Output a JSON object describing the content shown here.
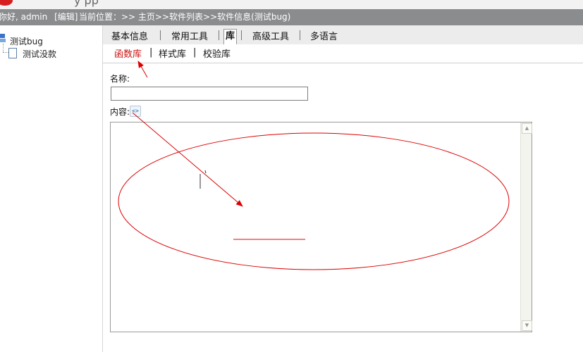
{
  "header": {
    "app_title_fragment": "y pp",
    "greeting": "你好, admin",
    "edit_link": "[编辑]",
    "location": "当前位置：>> 主页>>软件列表>>软件信息(测试bug)"
  },
  "sidebar": {
    "tree": {
      "root_label": "测试bug",
      "child_label": "测试没款"
    }
  },
  "tabs": [
    {
      "label": "基本信息"
    },
    {
      "label": "常用工具"
    },
    {
      "label": "库",
      "active": true
    },
    {
      "label": "高级工具"
    },
    {
      "label": "多语言"
    }
  ],
  "subtabs": {
    "items": [
      {
        "label": "函数库",
        "active": true
      },
      {
        "label": "样式库"
      },
      {
        "label": "校验库"
      }
    ],
    "separator": "|"
  },
  "form": {
    "name_label": "名称:",
    "name_value": "",
    "content_label": "内容:",
    "source_icon": "code-source-icon",
    "content_value": ""
  },
  "colors": {
    "statusbar": "#8a8c8e",
    "active_subtab": "#cc1111",
    "annotation": "#dd0000"
  }
}
